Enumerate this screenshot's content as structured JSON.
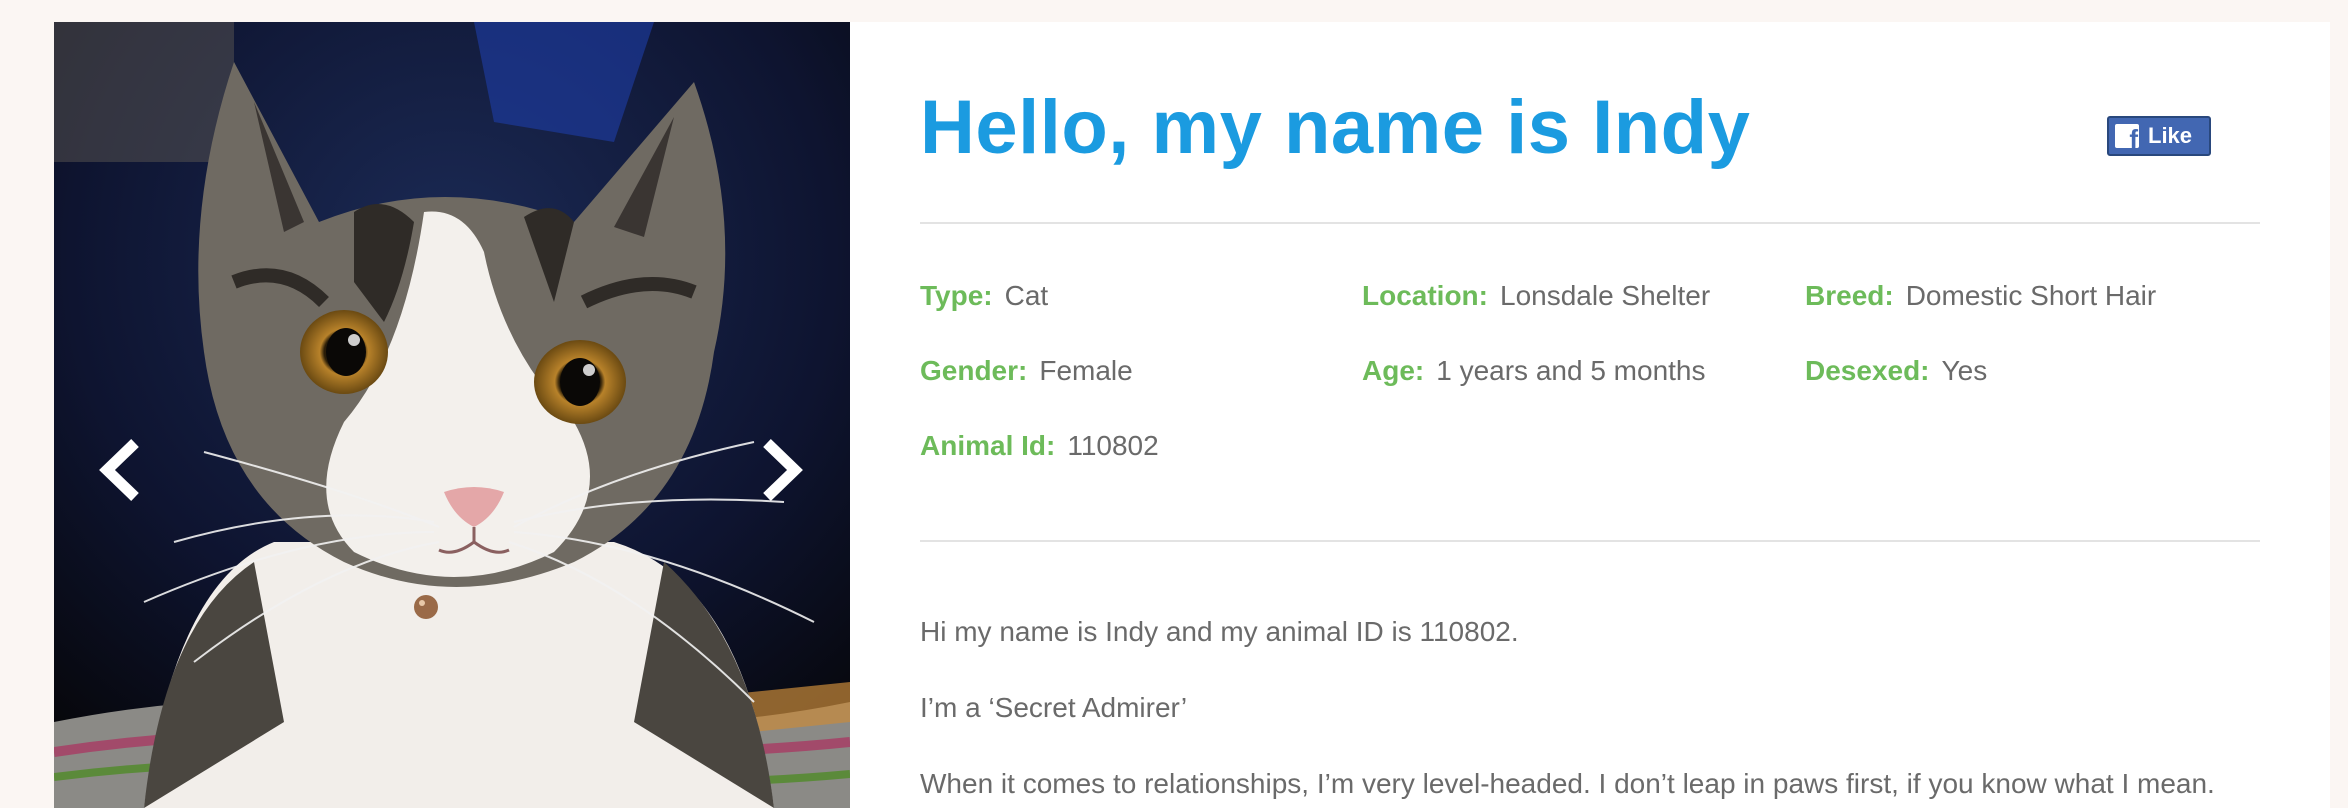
{
  "pet": {
    "title": "Hello, my name is Indy",
    "attributes": [
      {
        "label": "Type:",
        "value": "Cat"
      },
      {
        "label": "Location:",
        "value": "Lonsdale Shelter"
      },
      {
        "label": "Breed:",
        "value": "Domestic Short Hair"
      },
      {
        "label": "Gender:",
        "value": "Female"
      },
      {
        "label": "Age:",
        "value": "1 years and 5 months"
      },
      {
        "label": "Desexed:",
        "value": "Yes"
      },
      {
        "label": "Animal Id:",
        "value": "110802"
      }
    ],
    "description": [
      "Hi my name is Indy and my animal ID is 110802.",
      "I’m a ‘Secret Admirer’",
      "When it comes to relationships, I’m very level-headed. I don’t leap in paws first, if you know what I mean."
    ]
  },
  "social": {
    "like_label": "Like",
    "logo_glyph": "f"
  },
  "gallery": {
    "prev_icon": "chevron-left-icon",
    "next_icon": "chevron-right-icon"
  },
  "colors": {
    "title": "#1b9be0",
    "label": "#6dbb5a",
    "value": "#6a6a6a",
    "facebook": "#4267b2",
    "background": "#fbf6f3"
  }
}
